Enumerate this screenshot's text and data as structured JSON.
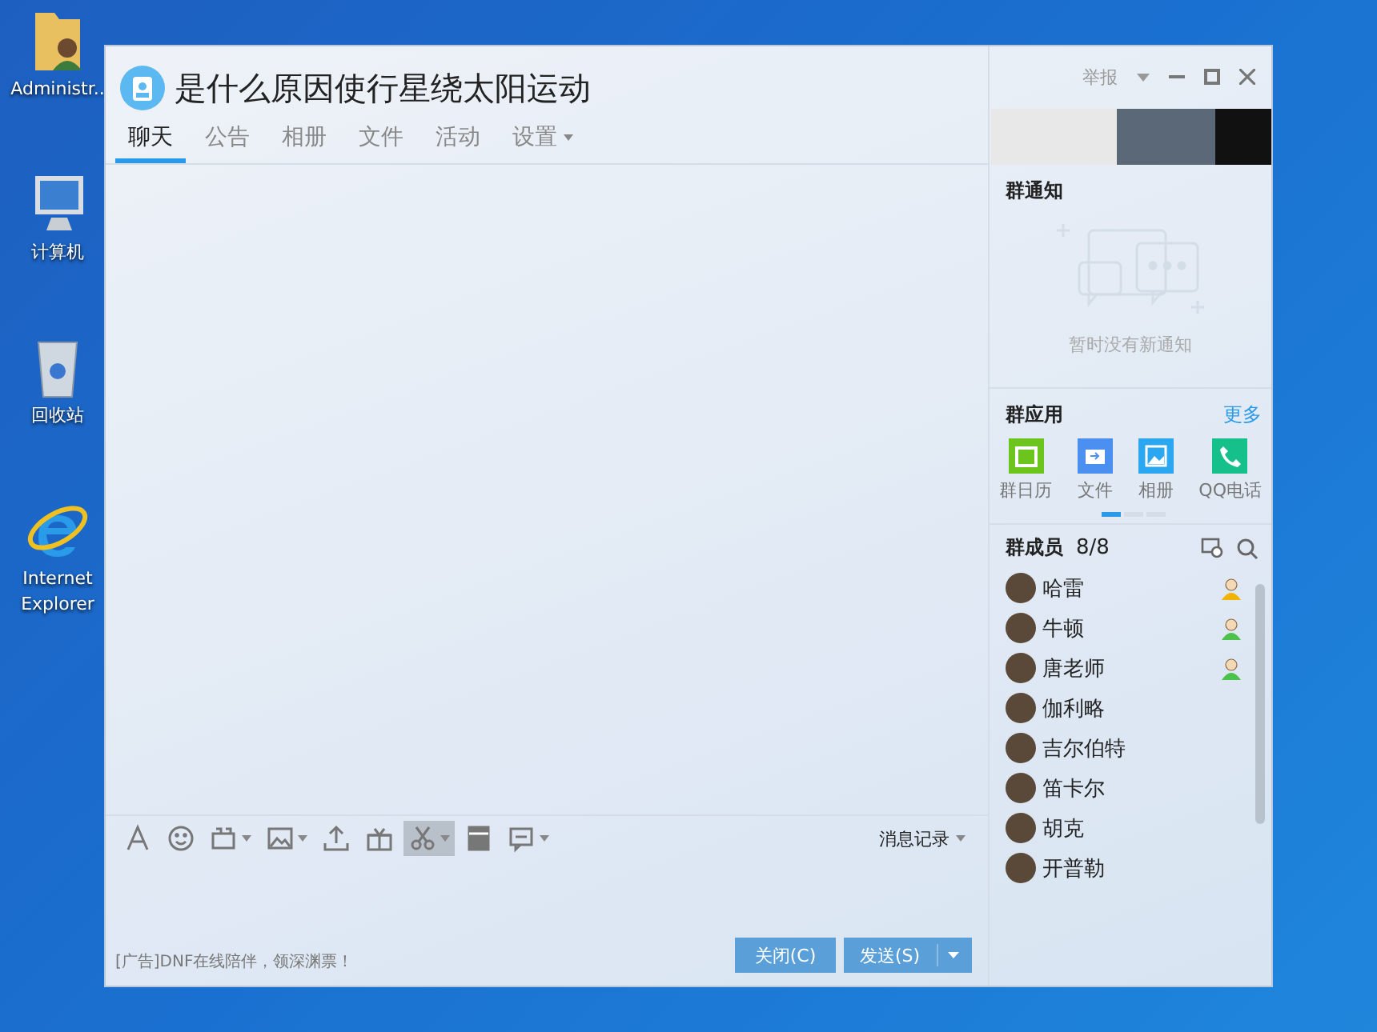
{
  "desktop_icons": [
    {
      "kind": "user-folder",
      "label": "Administr.."
    },
    {
      "kind": "computer",
      "label": "计算机"
    },
    {
      "kind": "recycle-bin",
      "label": "回收站"
    },
    {
      "kind": "browser",
      "label": "Internet Explorer"
    }
  ],
  "window": {
    "title": "是什么原因使行星绕太阳运动",
    "report": "举报"
  },
  "tabs": [
    {
      "label": "聊天",
      "selected": true,
      "dropdown": false
    },
    {
      "label": "公告",
      "selected": false,
      "dropdown": false
    },
    {
      "label": "相册",
      "selected": false,
      "dropdown": false
    },
    {
      "label": "文件",
      "selected": false,
      "dropdown": false
    },
    {
      "label": "活动",
      "selected": false,
      "dropdown": false
    },
    {
      "label": "设置",
      "selected": false,
      "dropdown": true
    }
  ],
  "toolbar": [
    {
      "kind": "font",
      "dropdown": false,
      "selected": false
    },
    {
      "kind": "emoji",
      "dropdown": false,
      "selected": false
    },
    {
      "kind": "gif",
      "dropdown": true,
      "selected": false
    },
    {
      "kind": "image",
      "dropdown": true,
      "selected": false
    },
    {
      "kind": "upload",
      "dropdown": false,
      "selected": false
    },
    {
      "kind": "gift",
      "dropdown": false,
      "selected": false
    },
    {
      "kind": "scissors",
      "dropdown": true,
      "selected": true
    },
    {
      "kind": "envelope",
      "dropdown": false,
      "selected": false
    },
    {
      "kind": "chat",
      "dropdown": true,
      "selected": false
    }
  ],
  "history": "消息记录",
  "footer": {
    "ad": "[广告]DNF在线陪伴，领深渊票！",
    "close_button": "关闭(C)",
    "send_button": "发送(S)"
  },
  "notice": {
    "title": "群通知",
    "empty": "暂时没有新通知"
  },
  "apps": {
    "title": "群应用",
    "more": "更多",
    "items": [
      {
        "kind": "calendar",
        "label": "群日历"
      },
      {
        "kind": "file",
        "label": "文件"
      },
      {
        "kind": "album",
        "label": "相册"
      },
      {
        "kind": "phone",
        "label": "QQ电话"
      }
    ],
    "pager": [
      {
        "selected": true
      },
      {
        "selected": false
      },
      {
        "selected": false
      }
    ]
  },
  "members": {
    "title": "群成员",
    "count": "8/8",
    "items": [
      {
        "name": "哈雷",
        "kind": "owner"
      },
      {
        "name": "牛顿",
        "kind": "admin"
      },
      {
        "name": "唐老师",
        "kind": "admin"
      },
      {
        "name": "伽利略",
        "kind": "member"
      },
      {
        "name": "吉尔伯特",
        "kind": "member"
      },
      {
        "name": "笛卡尔",
        "kind": "member"
      },
      {
        "name": "胡克",
        "kind": "member"
      },
      {
        "name": "开普勒",
        "kind": "member"
      }
    ]
  }
}
